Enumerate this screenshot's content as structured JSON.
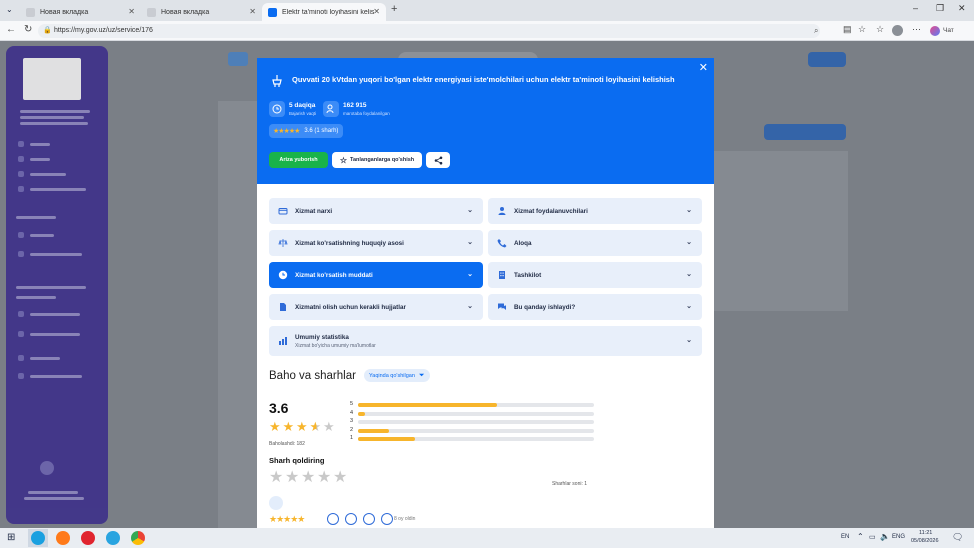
{
  "browser": {
    "tabs": [
      {
        "label": "Новая вкладка",
        "active": false
      },
      {
        "label": "Новая вкладка",
        "active": false
      },
      {
        "label": "Elektr ta'minoti loyihasini kelishish",
        "active": true
      }
    ],
    "new_tab": "+",
    "url": "https://my.gov.uz/uz/service/176",
    "chat_label": "Чат"
  },
  "modal": {
    "title": "Quvvati 20 kVtdan yuqori bo'lgan elektr energiyasi iste'molchilari uchun elektr ta'minoti loyihasini kelishish",
    "close": "✕",
    "duration_value": "5 daqiqa",
    "duration_sub": "Bajarish vaqti",
    "users_value": "162 915",
    "users_sub": "marotaba foydalanilgan",
    "rating_chip": "3.6 (1 sharh)",
    "btn_apply": "Ariza yuborish",
    "btn_favorite": "Tanlanganlarga qo'shish",
    "accordion": [
      {
        "label": "Xizmat narxi",
        "icon": "card-icon",
        "active": false
      },
      {
        "label": "Xizmat foydalanuvchilari",
        "icon": "user-icon",
        "active": false
      },
      {
        "label": "Xizmat ko'rsatishning huquqiy asosi",
        "icon": "scales-icon",
        "active": false
      },
      {
        "label": "Aloqa",
        "icon": "phone-icon",
        "active": false
      },
      {
        "label": "Xizmat ko'rsatish muddati",
        "icon": "clock-icon",
        "active": true
      },
      {
        "label": "Tashkilot",
        "icon": "building-icon",
        "active": false
      },
      {
        "label": "Xizmatni olish uchun kerakli hujjatlar",
        "icon": "document-icon",
        "active": false
      },
      {
        "label": "Bu qanday ishlaydi?",
        "icon": "chat-icon",
        "active": false
      }
    ],
    "stats_title": "Umumiy statistika",
    "stats_sub": "Xizmat bo'yicha umumiy ma'lumotlar",
    "reviews_title": "Baho va sharhlar",
    "sort_label": "Yaqinda qo'shilgan",
    "avg_rating": "3.6",
    "avg_stars": 3.6,
    "rated_label": "Baholashdi: 182",
    "distribution": [
      {
        "star": "5",
        "fraction": 0.59
      },
      {
        "star": "4",
        "fraction": 0.03
      },
      {
        "star": "3",
        "fraction": 0.0
      },
      {
        "star": "2",
        "fraction": 0.13
      },
      {
        "star": "1",
        "fraction": 0.24
      }
    ],
    "leave_review": "Sharh qoldiring",
    "reviews_count": "Sharhlar soni: 1",
    "review_time": "8 oy oldin"
  },
  "taskbar": {
    "lang": "EN",
    "lang2": "ENG",
    "time": "11:21",
    "date": "05/08/2026"
  },
  "colors": {
    "primary": "#0a6cf1",
    "green": "#19b34a",
    "star": "#f7b52c",
    "sidebar": "#3a2b8a"
  }
}
